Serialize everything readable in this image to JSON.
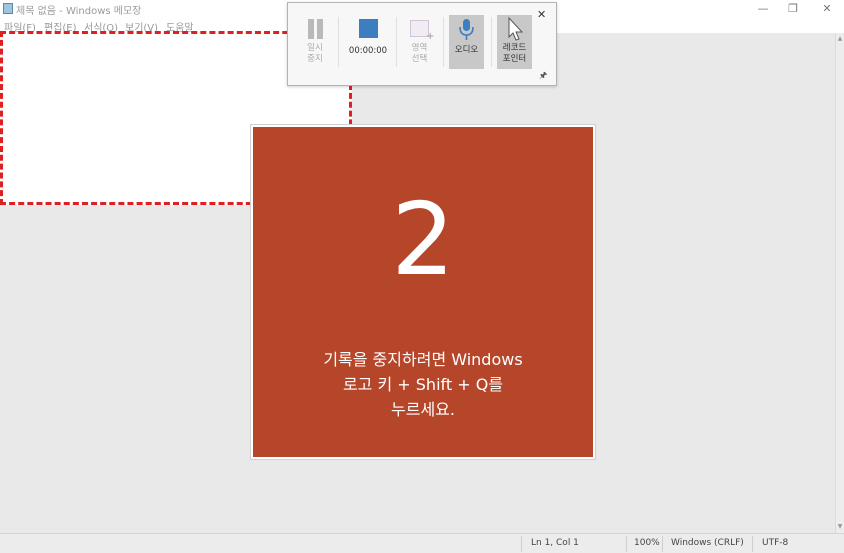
{
  "window": {
    "title": "제목 없음 - Windows 메모장",
    "minimize_glyph": "—",
    "restore_glyph": "❐",
    "close_glyph": "✕"
  },
  "menu": {
    "items": [
      "파일(F)",
      "편집(E)",
      "서식(O)",
      "보기(V)",
      "도움말"
    ]
  },
  "recorder": {
    "pause_label": "일시\n중지",
    "timer": "00:00:00",
    "region_label": "영역\n선택",
    "audio_label": "오디오",
    "pointer_label": "레코드\n포인터",
    "close_glyph": "✕",
    "pin_glyph": "🖈"
  },
  "countdown": {
    "number": "2",
    "message": "기록을 중지하려면 Windows\n로고 키 + Shift + Q를\n누르세요."
  },
  "status": {
    "position": "Ln 1, Col 1",
    "zoom": "100%",
    "line_ending": "Windows (CRLF)",
    "encoding": "UTF-8"
  },
  "colors": {
    "countdown_bg": "#b6462a",
    "selection_dash": "#e02020",
    "stop_button": "#3d7ec1",
    "mic_icon": "#3d7ec1"
  },
  "icons": {
    "app": "notepad-icon",
    "pause": "pause-icon",
    "stop": "stop-icon",
    "region": "region-select-icon",
    "audio": "microphone-icon",
    "pointer": "cursor-icon",
    "pin": "pin-icon"
  }
}
